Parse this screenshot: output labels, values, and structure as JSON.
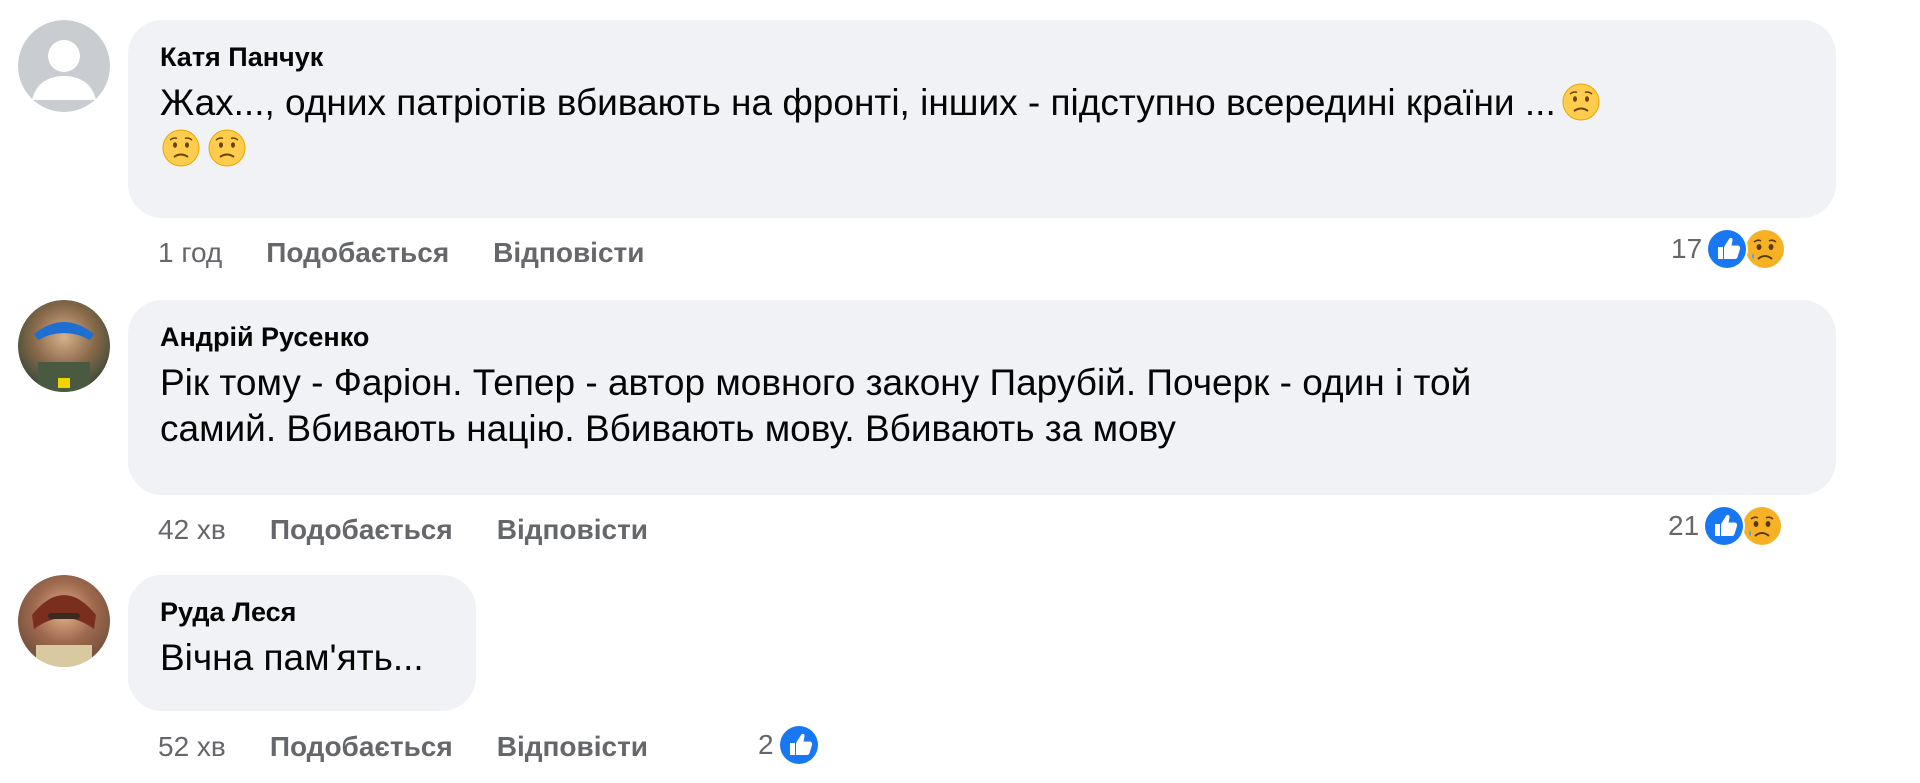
{
  "comments": [
    {
      "author": "Катя Панчук",
      "text_line1": "Жах..., одних патріотів вбивають на фронті, інших - підступно всередині країни ...",
      "time": "1 год",
      "like_label": "Подобається",
      "reply_label": "Відповісти",
      "reaction_count": "17",
      "reactions": [
        "like-icon",
        "sad-icon"
      ],
      "emoji": "sad-face-emoji"
    },
    {
      "author": "Андрій Русенко",
      "text_line1": "Рік тому - Фаріон. Тепер - автор мовного закону Парубій. Почерк - один і той",
      "text_line2": "самий. Вбивають націю. Вбивають мову. Вбивають за мову",
      "time": "42 хв",
      "like_label": "Подобається",
      "reply_label": "Відповісти",
      "reaction_count": "21",
      "reactions": [
        "like-icon",
        "sad-icon"
      ]
    },
    {
      "author": "Руда Леся",
      "text_line1": "Вічна пам'ять...",
      "time": "52 хв",
      "like_label": "Подобається",
      "reply_label": "Відповісти",
      "reaction_count": "2",
      "reactions": [
        "like-icon"
      ]
    }
  ],
  "colors": {
    "bubble": "#f0f2f5",
    "meta_text": "#65676b",
    "like_blue": "#1877f2",
    "sad_yellow": "#f7b125"
  }
}
